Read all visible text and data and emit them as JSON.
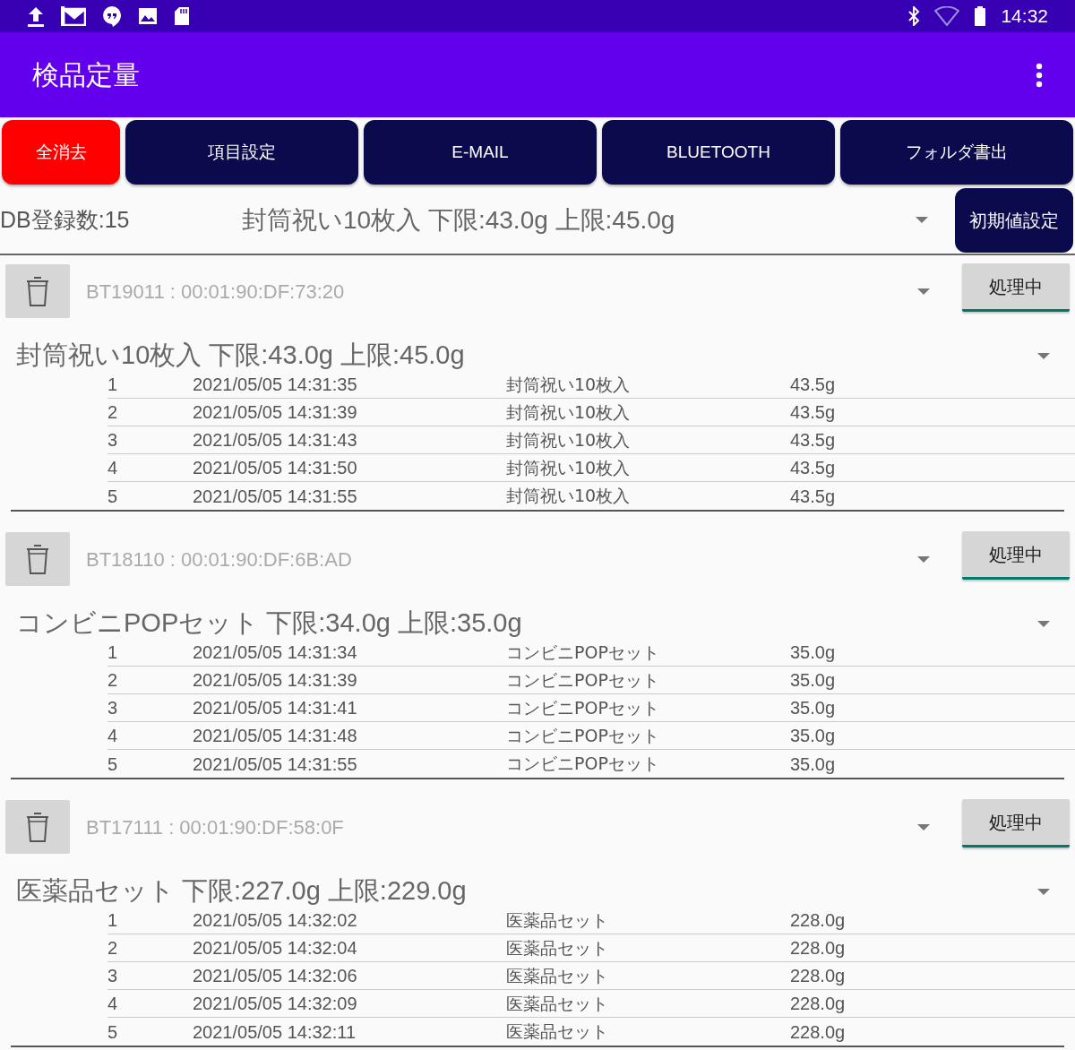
{
  "status_bar": {
    "time": "14:32"
  },
  "app_bar": {
    "title": "検品定量"
  },
  "toolbar": [
    {
      "label": "全消去",
      "kind": "danger"
    },
    {
      "label": "項目設定",
      "kind": "normal"
    },
    {
      "label": "E-MAIL",
      "kind": "normal"
    },
    {
      "label": "BLUETOOTH",
      "kind": "normal"
    },
    {
      "label": "フォルダ書出",
      "kind": "normal"
    }
  ],
  "summary": {
    "db_count": "DB登録数:15",
    "product_select": "封筒祝い10枚入 下限:43.0g 上限:45.0g",
    "reset_button": "初期値設定"
  },
  "devices": [
    {
      "device": "BT19011 : 00:01:90:DF:73:20",
      "status_button": "処理中",
      "product": "封筒祝い10枚入 下限:43.0g 上限:45.0g",
      "rows": [
        [
          "1",
          "2021/05/05 14:31:35",
          "封筒祝い10枚入",
          "43.5g"
        ],
        [
          "2",
          "2021/05/05 14:31:39",
          "封筒祝い10枚入",
          "43.5g"
        ],
        [
          "3",
          "2021/05/05 14:31:43",
          "封筒祝い10枚入",
          "43.5g"
        ],
        [
          "4",
          "2021/05/05 14:31:50",
          "封筒祝い10枚入",
          "43.5g"
        ],
        [
          "5",
          "2021/05/05 14:31:55",
          "封筒祝い10枚入",
          "43.5g"
        ]
      ]
    },
    {
      "device": "BT18110 : 00:01:90:DF:6B:AD",
      "status_button": "処理中",
      "product": "コンビニPOPセット 下限:34.0g 上限:35.0g",
      "rows": [
        [
          "1",
          "2021/05/05 14:31:34",
          "コンビニPOPセット",
          "35.0g"
        ],
        [
          "2",
          "2021/05/05 14:31:39",
          "コンビニPOPセット",
          "35.0g"
        ],
        [
          "3",
          "2021/05/05 14:31:41",
          "コンビニPOPセット",
          "35.0g"
        ],
        [
          "4",
          "2021/05/05 14:31:48",
          "コンビニPOPセット",
          "35.0g"
        ],
        [
          "5",
          "2021/05/05 14:31:55",
          "コンビニPOPセット",
          "35.0g"
        ]
      ]
    },
    {
      "device": "BT17111 : 00:01:90:DF:58:0F",
      "status_button": "処理中",
      "product": "医薬品セット 下限:227.0g 上限:229.0g",
      "rows": [
        [
          "1",
          "2021/05/05 14:32:02",
          "医薬品セット",
          "228.0g"
        ],
        [
          "2",
          "2021/05/05 14:32:04",
          "医薬品セット",
          "228.0g"
        ],
        [
          "3",
          "2021/05/05 14:32:06",
          "医薬品セット",
          "228.0g"
        ],
        [
          "4",
          "2021/05/05 14:32:09",
          "医薬品セット",
          "228.0g"
        ],
        [
          "5",
          "2021/05/05 14:32:11",
          "医薬品セット",
          "228.0g"
        ]
      ]
    }
  ]
}
